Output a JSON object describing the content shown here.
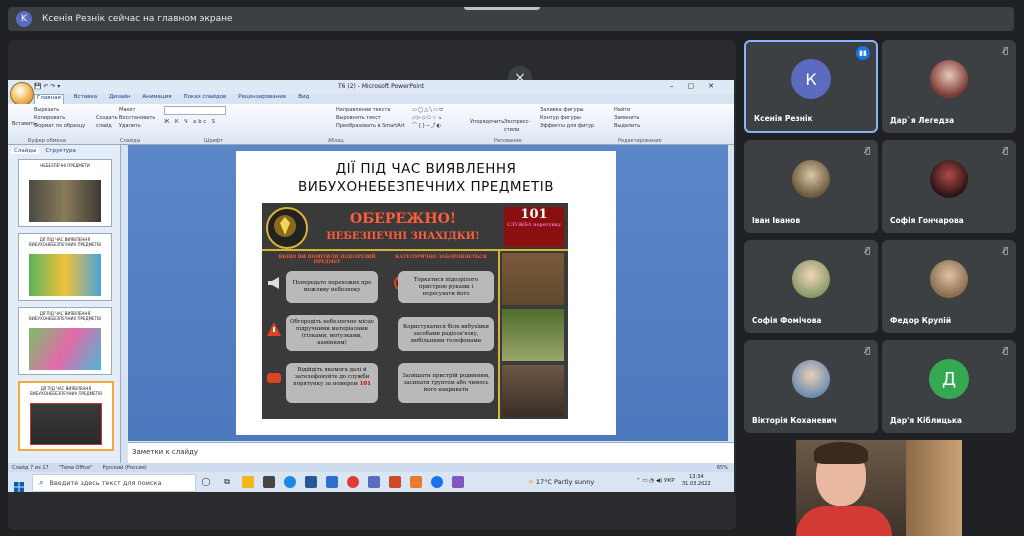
{
  "meet": {
    "presenter_initial": "K",
    "presenter_banner": "Ксенія Резнік сейчас на главном экране",
    "close_glyph": "×"
  },
  "ppt": {
    "window_title": "Т6 (2) - Microsoft PowerPoint",
    "ribbon_tabs": [
      "Главная",
      "Вставка",
      "Дизайн",
      "Анимация",
      "Показ слайдов",
      "Рецензирование",
      "Вид"
    ],
    "ribbon_groups": {
      "clipboard": {
        "paste": "Вставить",
        "cut": "Вырезать",
        "copy": "Копировать",
        "format": "Формат по образцу",
        "label": "Буфер обмена"
      },
      "slides": {
        "create": "Создать слайд",
        "layout": "Макет",
        "reset": "Восстановить",
        "delete": "Удалить",
        "label": "Слайды"
      },
      "font": {
        "label": "Шрифт"
      },
      "paragraph": {
        "label": "Абзац",
        "direction": "Направление текста",
        "align": "Выровнять текст",
        "smartart": "Преобразовать в SmartArt"
      },
      "drawing": {
        "label": "Рисование",
        "arrange": "Упорядочить",
        "styles": "Экспресс-стили",
        "fill": "Заливка фигуры",
        "outline": "Контур фигуры",
        "effects": "Эффекты для фигур"
      },
      "editing": {
        "label": "Редактирование",
        "find": "Найти",
        "replace": "Заменить",
        "select": "Выделить"
      }
    },
    "side_tabs": [
      "Слайды",
      "Структура"
    ],
    "thumbnails": [
      {
        "num": "4",
        "title": "НЕБЕЗПЕЧНІ ПРЕДМЕТИ"
      },
      {
        "num": "5",
        "title": "ДІЇ ПІД ЧАС ВИЯВЛЕННЯ ВИБУХОНЕБЕЗПЕЧНИХ ПРЕДМЕТІВ"
      },
      {
        "num": "6",
        "title": "ДІЇ ПІД ЧАС ВИЯВЛЕННЯ ВИБУХОНЕБЕЗПЕЧНИХ ПРЕДМЕТІВ"
      },
      {
        "num": "7",
        "title": "ДІЇ ПІД ЧАС ВИЯВЛЕННЯ ВИБУХОНЕБЕЗПЕЧНИХ ПРЕДМЕТІВ"
      }
    ],
    "slide": {
      "title_line1": "ДІЇ ПІД ЧАС ВИЯВЛЕННЯ",
      "title_line2": "ВИБУХОНЕБЕЗПЕЧНИХ ПРЕДМЕТІВ",
      "poster": {
        "warn_a": "ОБЕРЕЖНО!",
        "warn_b": "НЕБЕЗПЕЧНІ ЗНАХІДКИ!",
        "num": "101",
        "service": "СЛУЖБА порятунку",
        "col_left": "ЯКЩО ВИ ПОМІТИЛИ ПІДОЗРІЛИЙ ПРЕДМЕТ",
        "col_right": "КАТЕГОРИЧНО ЗАБОРОНЯЄТЬСЯ",
        "l1": "Попередьте перехожих про можливу небезпеку",
        "l2": "Обгородіть небезпечне місце підручними матеріалами (гілками, мотузками, камінням)",
        "l3a": "Відійдіть якомога далі й зателефонуйте до служби порятунку за номером",
        "l3b": "101",
        "r1": "Торкатися підозрілого пристрою руками і пересувати його",
        "r2": "Користуватися біля вибухівки засобами радіозв'язку, мобільними телефонами",
        "r3": "Залишати пристрій родинним, засипати ґрунтом або чимось його накривати"
      }
    },
    "notes_placeholder": "Заметки к слайду",
    "status": {
      "slide": "Слайд 7 из 17",
      "theme": "\"Тема Office\"",
      "lang": "Русский (Россия)",
      "zoom": "65%"
    },
    "taskbar": {
      "search_placeholder": "Введите здесь текст для поиска",
      "weather": "17°C  Partly sunny",
      "lang": "УКР",
      "time": "13:34",
      "date": "31.03.2022"
    }
  },
  "participants": [
    {
      "name": "Ксенія Резнік",
      "initial": "К",
      "color": "#5c6bc0",
      "speaking": true
    },
    {
      "name": "Дар`я Легедза",
      "photo": "#7b3a35"
    },
    {
      "name": "Іван Іванов",
      "photo": "#6e5a3c"
    },
    {
      "name": "Софія Гончарова",
      "photo": "#2a1414"
    },
    {
      "name": "Софія Фомічова",
      "photo": "#8a9b6a"
    },
    {
      "name": "Федор Крупій",
      "photo": "#8a6e4f"
    },
    {
      "name": "Вікторія Коханевич",
      "photo": "#6f8eb3"
    },
    {
      "name": "Дар'я Кіблицька",
      "initial": "Д",
      "color": "#34a853"
    }
  ],
  "colors": {
    "meet_bg": "#202124",
    "tile_bg": "#3c4043",
    "accent": "#8ab4f8",
    "warning_red": "#ff5d3a",
    "gold": "#d6b43a"
  }
}
